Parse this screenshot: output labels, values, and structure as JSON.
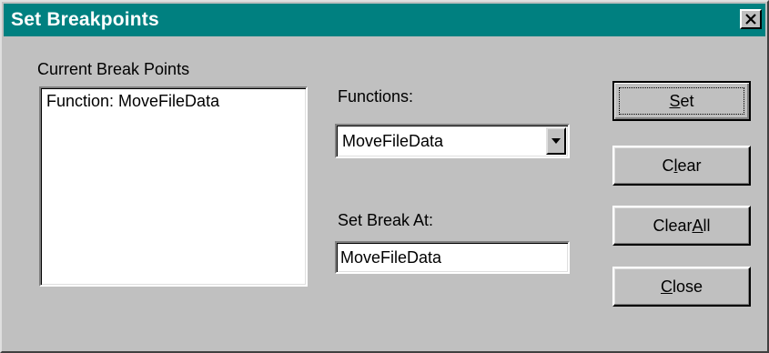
{
  "window": {
    "title": "Set Breakpoints"
  },
  "breakpoints": {
    "label": "Current Break Points",
    "items": [
      "Function: MoveFileData"
    ]
  },
  "functions": {
    "label": "Functions:",
    "selected": "MoveFileData"
  },
  "break_at": {
    "label": "Set Break At:",
    "value": "MoveFileData"
  },
  "buttons": {
    "set": {
      "pre": "",
      "key": "S",
      "post": "et"
    },
    "clear": {
      "pre": "C",
      "key": "l",
      "post": "ear"
    },
    "clear_all": {
      "pre": "Clear",
      "key": "A",
      "post": "ll"
    },
    "close": {
      "pre": "",
      "key": "C",
      "post": "lose"
    }
  },
  "icons": {
    "close": "close-x-icon",
    "dropdown": "triangle-down-icon"
  },
  "colors": {
    "titlebar": "#008080",
    "face": "#c0c0c0",
    "field": "#ffffff"
  }
}
